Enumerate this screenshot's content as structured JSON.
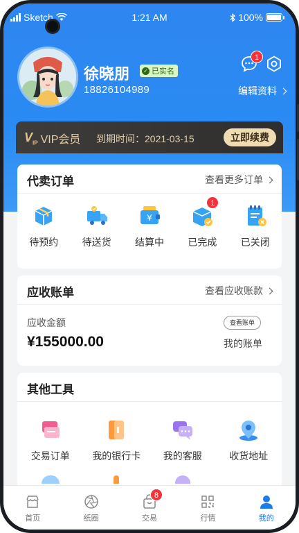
{
  "status_bar": {
    "carrier": "Sketch",
    "time": "1:21 AM",
    "battery": "100%"
  },
  "profile": {
    "name": "徐晓朋",
    "verified_label": "已实名",
    "phone": "18826104989",
    "message_badge": "1",
    "edit_label": "编辑资料"
  },
  "vip": {
    "logo_mark": "V",
    "logo_sub": "IP",
    "title": "VIP会员",
    "expire_label": "到期时间：",
    "expire_date": "2021-03-15",
    "renew_label": "立即续费"
  },
  "orders": {
    "title": "代卖订单",
    "more_label": "查看更多订单",
    "items": [
      {
        "label": "待预约",
        "icon": "box-icon"
      },
      {
        "label": "待送货",
        "icon": "truck-icon"
      },
      {
        "label": "结算中",
        "icon": "wallet-icon"
      },
      {
        "label": "已完成",
        "icon": "box-check-icon",
        "badge": "1"
      },
      {
        "label": "已关闭",
        "icon": "notepad-close-icon"
      }
    ]
  },
  "receivables": {
    "title": "应收账单",
    "more_label": "查看应收账款",
    "amount_label": "应收金额",
    "amount": "¥155000.00",
    "view_bill_tag": "查看账单",
    "my_bill_label": "我的账单"
  },
  "tools": {
    "title": "其他工具",
    "items": [
      {
        "label": "交易订单",
        "icon": "order-card-icon"
      },
      {
        "label": "我的银行卡",
        "icon": "bank-card-icon"
      },
      {
        "label": "我的客服",
        "icon": "chat-bubbles-icon"
      },
      {
        "label": "收货地址",
        "icon": "location-pin-icon"
      }
    ]
  },
  "tabbar": {
    "items": [
      {
        "label": "首页",
        "icon": "store-icon"
      },
      {
        "label": "纸圈",
        "icon": "aperture-icon"
      },
      {
        "label": "交易",
        "icon": "bag-icon",
        "badge": "8"
      },
      {
        "label": "行情",
        "icon": "grid-icon"
      },
      {
        "label": "我的",
        "icon": "person-icon",
        "active": true
      }
    ]
  },
  "colors": {
    "primary": "#2a8bf3",
    "badge": "#f2333c",
    "vip_gold": "#e8cda0"
  }
}
